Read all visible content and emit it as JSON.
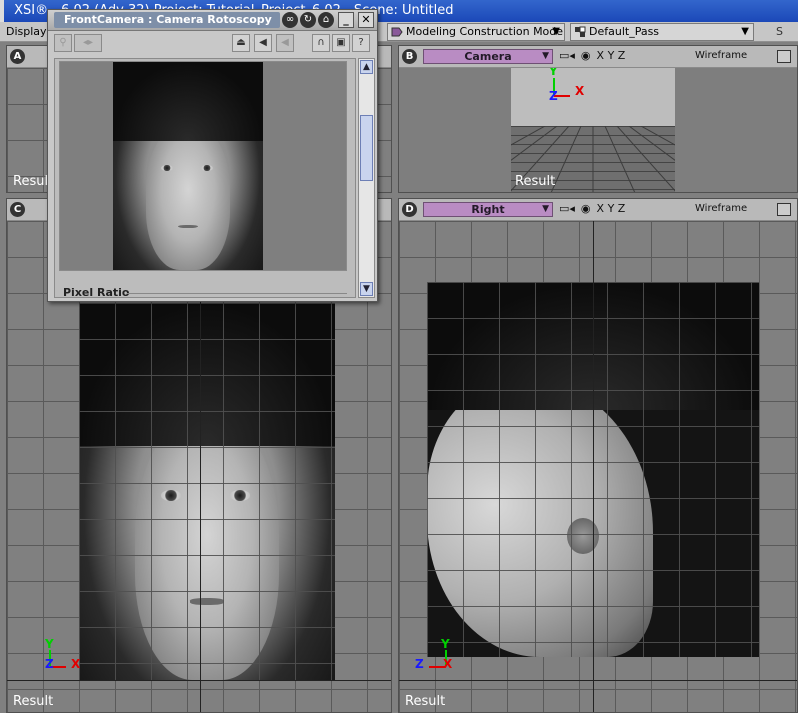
{
  "app": {
    "title": "XSI® - 6.02 (Adv 32) Project: Tutorial_Project_6.02 - Scene: Untitled"
  },
  "menu": {
    "display_label": "Display",
    "mode_combo": "Modeling Construction Mode",
    "pass_combo": "Default_Pass",
    "strip_end": "S"
  },
  "viewports": {
    "a": {
      "letter": "A",
      "result": "Result"
    },
    "b": {
      "letter": "B",
      "camera": "Camera",
      "axes": "X Y Z",
      "shading": "Wireframe",
      "result": "Result"
    },
    "c": {
      "letter": "C",
      "result": "Result"
    },
    "d": {
      "letter": "D",
      "camera": "Right",
      "axes": "X Y Z",
      "shading": "Wireframe",
      "result": "Result"
    }
  },
  "axis_labels": {
    "y": "Y",
    "x": "X",
    "z": "Z"
  },
  "dialog": {
    "title": "FrontCamera : Camera Rotoscopy",
    "pixel_ratio_label": "Pixel Ratio"
  },
  "colors": {
    "title_bar": "#1b48b8",
    "camera_pill": "#b98cc3",
    "axis_x": "#e00000",
    "axis_y": "#00d000",
    "axis_z": "#1a1aff"
  },
  "icons": {
    "camera": "camera-icon",
    "eye": "eye-icon",
    "maximize": "maximize-icon",
    "close": "close-icon",
    "minimize": "minimize-icon",
    "help": "help-icon"
  }
}
